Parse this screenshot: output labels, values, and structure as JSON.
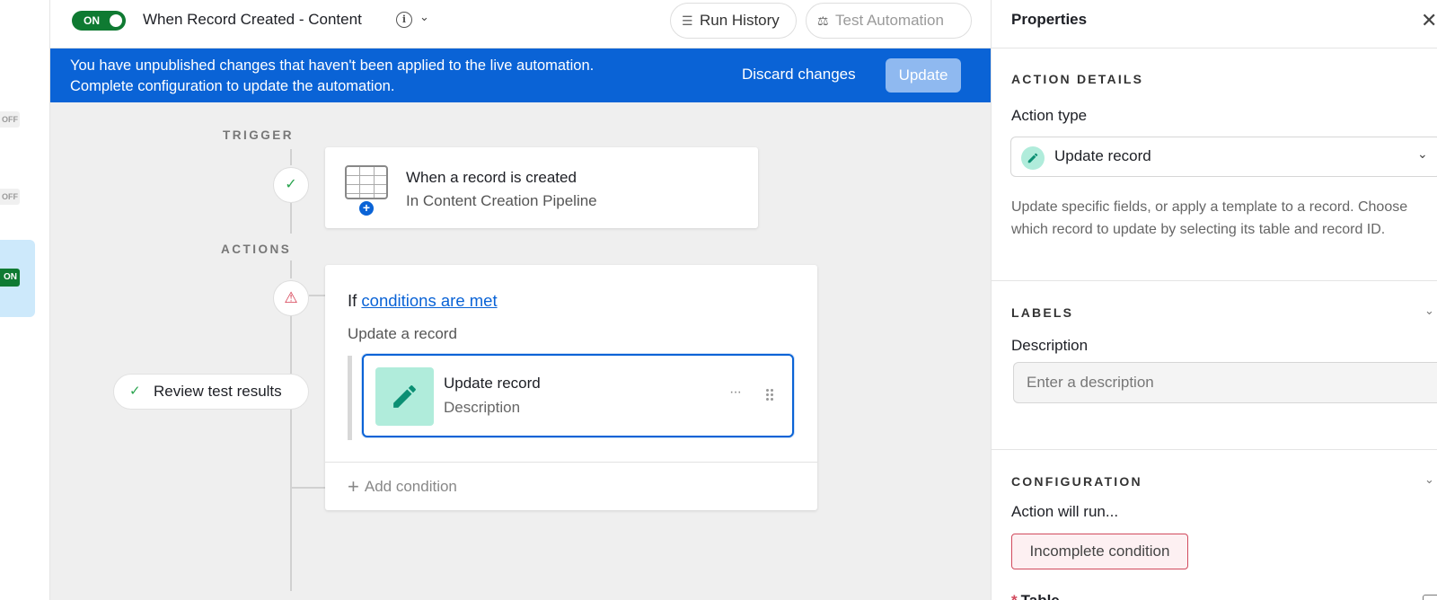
{
  "rail": {
    "off_badge": "OFF",
    "on_badge": "ON"
  },
  "topbar": {
    "toggle_label": "ON",
    "title": "When Record Created - Content",
    "run_history": "Run History",
    "test_automation": "Test Automation"
  },
  "banner": {
    "line1": "You have unpublished changes that haven't been applied to the live automation.",
    "line2": "Complete configuration to update the automation.",
    "discard": "Discard changes",
    "update": "Update"
  },
  "canvas": {
    "trigger_label": "TRIGGER",
    "actions_label": "ACTIONS",
    "trigger": {
      "title": "When a record is created",
      "subtitle": "In Content Creation Pipeline"
    },
    "condition_prefix": "If",
    "condition_link": "conditions are met",
    "sub_label": "Update a record",
    "action": {
      "title": "Update record",
      "subtitle": "Description"
    },
    "add_condition": "Add condition",
    "review": "Review test results"
  },
  "props": {
    "title": "Properties",
    "action_details": "ACTION DETAILS",
    "action_type_label": "Action type",
    "action_type_value": "Update record",
    "description": "Update specific fields, or apply a template to a record. Choose which record to update by selecting its table and record ID.",
    "labels": "LABELS",
    "description_label": "Description",
    "description_placeholder": "Enter a description",
    "configuration": "CONFIGURATION",
    "action_will_run": "Action will run...",
    "incomplete_condition": "Incomplete condition",
    "table_label": "Table"
  },
  "colors": {
    "accent": "#0a63d6",
    "on_green": "#0f7a32",
    "teal": "#b0ecdb",
    "error": "#d14a5d"
  }
}
